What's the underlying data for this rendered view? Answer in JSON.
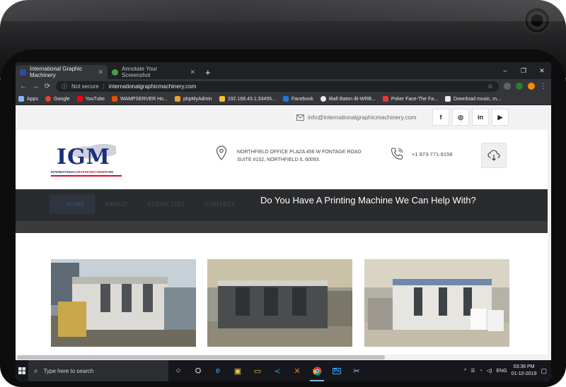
{
  "browser": {
    "tabs": [
      {
        "title": "International Graphic Machinery",
        "active": true,
        "favicon_color": "#2b4f9e"
      },
      {
        "title": "Annotate Your Screenshot",
        "active": false,
        "favicon_color": "#43a047"
      }
    ],
    "new_tab_symbol": "+",
    "window_controls": [
      "–",
      "❐",
      "✕"
    ],
    "address": {
      "security_label": "Not secure",
      "url": "internationalgraphicmachinery.com"
    },
    "bookmarks": [
      {
        "label": "Apps",
        "icon": "apps-grid-icon",
        "color": "#8ab4f8"
      },
      {
        "label": "Google",
        "icon": "google-icon",
        "color": "#ea4335"
      },
      {
        "label": "YouTube",
        "icon": "youtube-icon",
        "color": "#ff0000"
      },
      {
        "label": "WAMPSERVER Ho...",
        "icon": "wampserver-icon",
        "color": "#e65100"
      },
      {
        "label": "phpMyAdmin",
        "icon": "phpmyadmin-icon",
        "color": "#f0a030"
      },
      {
        "label": "192.168.43.1:33455...",
        "icon": "network-icon",
        "color": "#fbc02d"
      },
      {
        "label": "Facebook",
        "icon": "facebook-icon",
        "color": "#1877f2"
      },
      {
        "label": "iBall Baton iB-WRB...",
        "icon": "iball-icon",
        "color": "#e8eaed"
      },
      {
        "label": "Poker Face-The Fa...",
        "icon": "poker-face-icon",
        "color": "#e53935"
      },
      {
        "label": "Download music, m...",
        "icon": "download-page-icon",
        "color": "#e8eaed"
      }
    ]
  },
  "site": {
    "email": "info@internationalgraphicmachinery.com",
    "social": [
      "f",
      "◎",
      "in",
      "▶"
    ],
    "logo": {
      "text": "IGM",
      "tagline_a": "INTERNATIONAL",
      "tagline_b": "GRAPHICMACHINERY",
      "tagline_c": "INC"
    },
    "address_line1": "NORTHFIELD OFFICE PLAZA 456 W FONTAGE ROAD",
    "address_line2": "SUITE #102, NORTHFIELD IL 60093.",
    "phone": "+1 973-771-9159",
    "nav": [
      "HOME",
      "ABOUT",
      "STOCK LIST",
      "CONTACT"
    ],
    "headline": "Do You Have A Printing Machine We Can Help With?",
    "photos": [
      {
        "subject": "Komori printing press, four units, factory floor"
      },
      {
        "subject": "Komori printing press line in workshop"
      },
      {
        "subject": "Komori Lithrone printing press in warehouse"
      }
    ]
  },
  "taskbar": {
    "search_placeholder": "Type here to search",
    "language": "ENG",
    "time": "03:36 PM",
    "date": "01-10-2019",
    "apps": [
      "task-view-icon",
      "people-icon",
      "edge-icon",
      "store-icon",
      "file-explorer-icon",
      "vscode-icon",
      "xampp-icon",
      "chrome-icon",
      "photoshop-icon",
      "snipping-icon"
    ]
  }
}
